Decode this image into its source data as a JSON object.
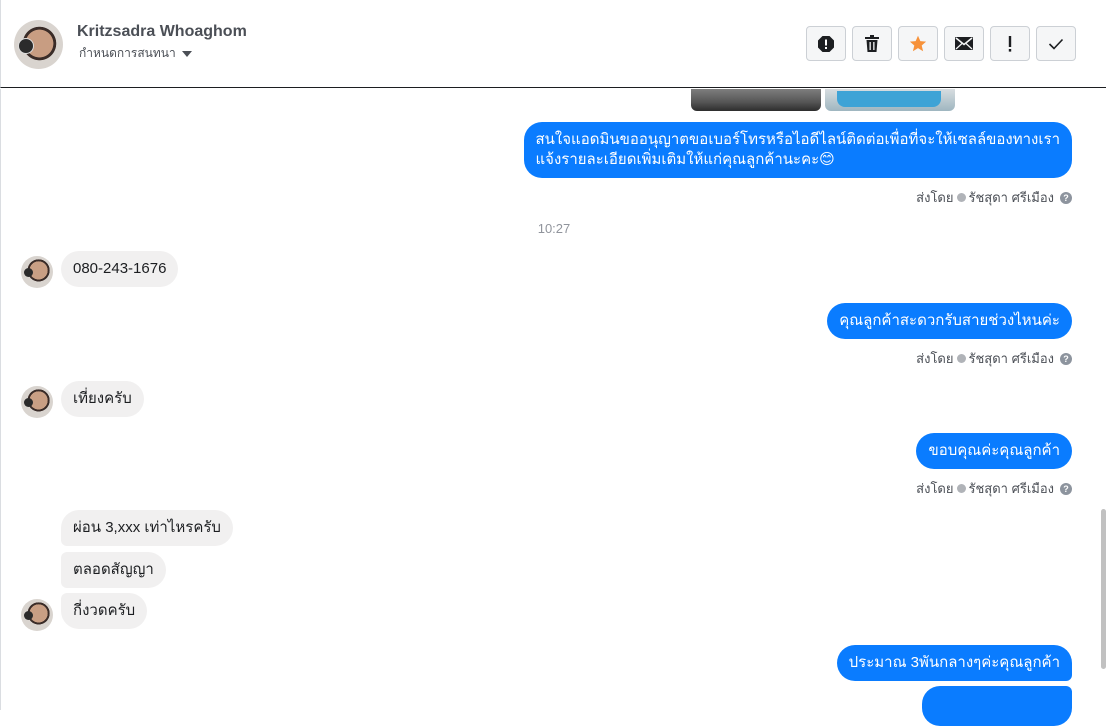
{
  "header": {
    "contact_name": "Kritzsadra Whoaghom",
    "assign_label": "กำหนดการสนทนา",
    "actions": [
      {
        "name": "report-spam-icon",
        "label": ""
      },
      {
        "name": "trash-icon",
        "label": ""
      },
      {
        "name": "star-icon",
        "label": ""
      },
      {
        "name": "envelope-icon",
        "label": ""
      },
      {
        "name": "exclamation-icon",
        "label": ""
      },
      {
        "name": "check-icon",
        "label": ""
      }
    ],
    "star_color": "#f7923a"
  },
  "thread": {
    "msg1_line1": "สนใจแอดมินขออนุญาตขอเบอร์โทรหรือไอดีไลน์ติดต่อเพื่อที่จะให้เซลล์ของทางเรา",
    "msg1_line2": "แจ้งรายละเอียดเพิ่มเติมให้แก่คุณลูกค้านะคะ😊",
    "sent_by_label": "ส่งโดย",
    "sender_name": "รัชสุดา ศรีเมือง",
    "timestamp": "10:27",
    "msg2": "080-243-1676",
    "msg3": "คุณลูกค้าสะดวกรับสายช่วงไหนค่ะ",
    "msg4": "เที่ยงครับ",
    "msg5": "ขอบคุณค่ะคุณลูกค้า",
    "msg6": "ผ่อน 3,xxx เท่าไหรครับ",
    "msg7": "ตลอดสัญญา",
    "msg8": "กี่งวดครับ",
    "msg9": "ประมาณ 3พันกลางๆค่ะคุณลูกค้า",
    "outgoing_color": "#0a7cff",
    "incoming_color": "#f1f0f0"
  }
}
